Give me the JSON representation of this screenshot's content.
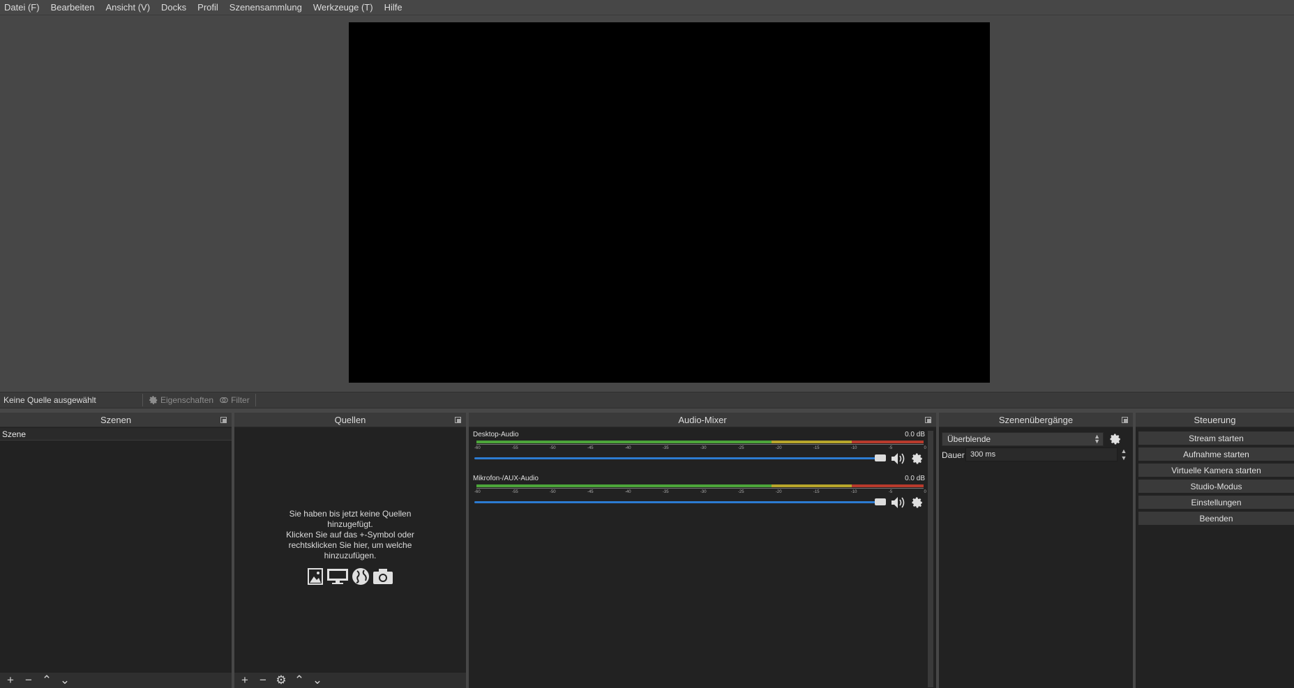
{
  "menu": [
    "Datei (F)",
    "Bearbeiten",
    "Ansicht (V)",
    "Docks",
    "Profil",
    "Szenensammlung",
    "Werkzeuge (T)",
    "Hilfe"
  ],
  "context": {
    "no_source": "Keine Quelle ausgewählt",
    "properties": "Eigenschaften",
    "filters": "Filter"
  },
  "scenes": {
    "title": "Szenen",
    "items": [
      "Szene"
    ]
  },
  "sources": {
    "title": "Quellen",
    "empty_line1": "Sie haben bis jetzt keine Quellen",
    "empty_line2": "hinzugefügt.",
    "empty_line3": "Klicken Sie auf das +-Symbol oder",
    "empty_line4": "rechtsklicken Sie hier, um welche",
    "empty_line5": "hinzuzufügen."
  },
  "mixer": {
    "title": "Audio-Mixer",
    "ticks": [
      "-60",
      "-55",
      "-50",
      "-45",
      "-40",
      "-35",
      "-30",
      "-25",
      "-20",
      "-15",
      "-10",
      "-5",
      "0"
    ],
    "channels": [
      {
        "name": "Desktop-Audio",
        "db": "0.0 dB",
        "volume": 1.0
      },
      {
        "name": "Mikrofon-/AUX-Audio",
        "db": "0.0 dB",
        "volume": 1.0
      }
    ]
  },
  "transitions": {
    "title": "Szenenübergänge",
    "selected": "Überblende",
    "duration_label": "Dauer",
    "duration_value": "300 ms"
  },
  "controls": {
    "title": "Steuerung",
    "buttons": [
      "Stream starten",
      "Aufnahme starten",
      "Virtuelle Kamera starten",
      "Studio-Modus",
      "Einstellungen",
      "Beenden"
    ]
  },
  "colors": {
    "meter_green": "#4ca53a",
    "meter_yellow": "#b8a62b",
    "meter_red": "#b83a2c",
    "volume_blue": "#2c7bd1"
  }
}
